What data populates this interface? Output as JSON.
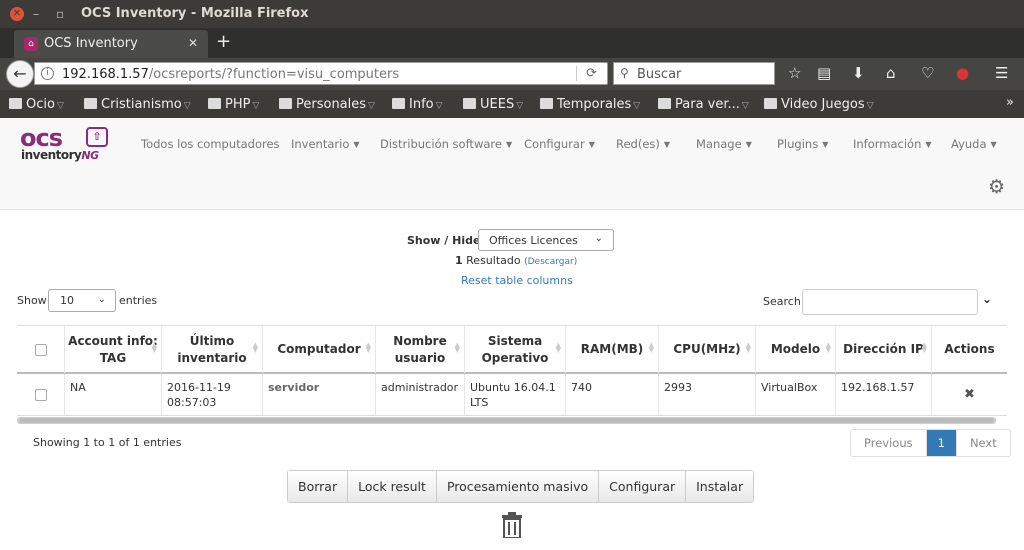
{
  "window": {
    "title": "OCS Inventory - Mozilla Firefox"
  },
  "tab": {
    "label": "OCS Inventory"
  },
  "url": {
    "host": "192.168.1.57",
    "path": "/ocsreports/?function=visu_computers"
  },
  "search": {
    "placeholder": "Buscar"
  },
  "bookmarks": [
    "Ocio",
    "Cristianismo",
    "PHP",
    "Personales",
    "Info",
    "UEES",
    "Temporales",
    "Para ver...",
    "Video Juegos"
  ],
  "logo": {
    "ocs": "ocs",
    "inventory": "inventory",
    "ng": "NG"
  },
  "menu": [
    "Todos los computadores",
    "Inventario",
    "Distribución software",
    "Configurar",
    "Red(es)",
    "Manage",
    "Plugins",
    "Información",
    "Ayuda"
  ],
  "filter": {
    "label": "Show / Hide :",
    "selected": "Offices Licences",
    "result_count": "1",
    "result_text": "Resultado",
    "download": "(Descargar)",
    "reset": "Reset table columns"
  },
  "table_controls": {
    "show": "Show",
    "length": "10",
    "entries": "entries",
    "search": "Search:"
  },
  "columns": [
    "Account info: TAG",
    "Último inventario",
    "Computador",
    "Nombre usuario",
    "Sistema Operativo",
    "RAM(MB)",
    "CPU(MHz)",
    "Modelo",
    "Dirección IP",
    "Actions"
  ],
  "rows": [
    {
      "tag": "NA",
      "last_inventory": "2016-11-19 08:57:03",
      "computer": "servidor",
      "user": "administrador",
      "os": "Ubuntu 16.04.1 LTS",
      "ram": "740",
      "cpu": "2993",
      "model": "VirtualBox",
      "ip": "192.168.1.57",
      "action": "✖"
    }
  ],
  "footer": {
    "showing": "Showing 1 to 1 of 1 entries",
    "previous": "Previous",
    "page": "1",
    "next": "Next"
  },
  "actions": [
    "Borrar",
    "Lock result",
    "Procesamiento masivo",
    "Configurar",
    "Instalar"
  ]
}
